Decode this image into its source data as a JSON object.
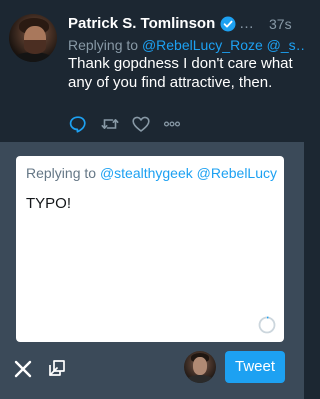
{
  "tweet": {
    "author_name": "Patrick S. Tomlinson",
    "verified": true,
    "more_indicator": "…",
    "timestamp": "37s",
    "replying_label": "Replying to",
    "replying_handles": "@RebelLucy_Roze @_s…",
    "text": "Thank gopdness I don't care what any of you find attractive, then."
  },
  "actions": [
    {
      "icon": "reply-icon"
    },
    {
      "icon": "retweet-icon"
    },
    {
      "icon": "like-icon"
    },
    {
      "icon": "more-icon"
    }
  ],
  "composer": {
    "replying_label": "Replying to",
    "replying_handles": "@stealthygeek @RebelLucy…",
    "input_value": "TYPO!",
    "tweet_button_label": "Tweet"
  },
  "colors": {
    "background": "#1c2732",
    "composer_background": "#3b4a59",
    "accent": "#1da1f2",
    "muted_text": "#8899a6"
  }
}
